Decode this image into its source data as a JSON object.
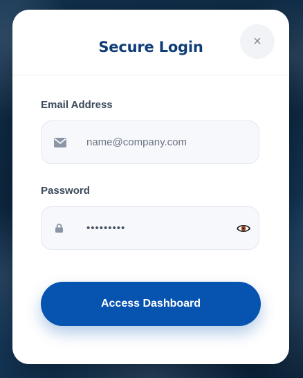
{
  "modal": {
    "title": "Secure Login",
    "close_label": "×"
  },
  "email": {
    "label": "Email Address",
    "placeholder": "name@company.com",
    "icon": "envelope-icon"
  },
  "password": {
    "label": "Password",
    "masked_value": "•••••••••",
    "icon": "lock-icon",
    "toggle_icon": "eye-icon"
  },
  "submit": {
    "label": "Access Dashboard"
  },
  "colors": {
    "title": "#0f3d78",
    "button": "#0753b0",
    "eye_iris": "#b0471e"
  }
}
